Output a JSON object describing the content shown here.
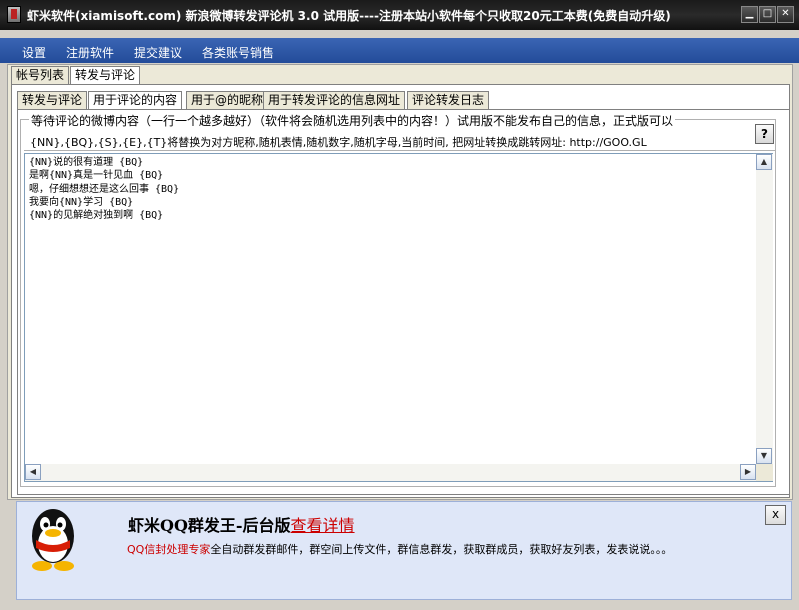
{
  "window": {
    "title": "虾米软件(xiamisoft.com) 新浪微博转发评论机 3.0 试用版----注册本站小软件每个只收取20元工本费(免费自动升级)",
    "min_glyph": "▁",
    "max_glyph": "□",
    "close_glyph": "✕"
  },
  "menu": {
    "items": [
      "设置",
      "注册软件",
      "提交建议",
      "各类账号销售"
    ]
  },
  "main_tabs": {
    "items": [
      "帐号列表",
      "转发与评论"
    ],
    "active_index": 1
  },
  "sub_tabs": {
    "items": [
      "转发与评论",
      "用于评论的内容",
      "用于@的昵称",
      "用于转发评论的信息网址",
      "评论转发日志"
    ],
    "active_index": 1
  },
  "group": {
    "legend": "等待评论的微博内容（一行一个越多越好）（软件将会随机选用列表中的内容！）试用版不能发布自己的信息，正式版可以",
    "help_label": "?",
    "hint": "{NN},{BQ},{S},{E},{T}将替换为对方昵称,随机表情,随机数字,随机字母,当前时间, 把网址转换成跳转网址: http://GOO.GL"
  },
  "editor": {
    "lines": [
      "{NN}说的很有道理 {BQ}",
      "是啊{NN}真是一针见血 {BQ}",
      "嗯，仔细想想还是这么回事 {BQ}",
      "我要向{NN}学习 {BQ}",
      "{NN}的见解绝对独到啊 {BQ}"
    ]
  },
  "ad": {
    "title": "虾米QQ群发王-后台版",
    "link": "查看详情",
    "desc_highlight": "QQ信封处理专家",
    "desc_rest": "全自动群发群邮件，群空间上传文件，群信息群发，获取群成员，获取好友列表，发表说说。。。",
    "close_label": "x"
  },
  "colors": {
    "menu_bg": "#2c56a6",
    "ad_bg": "#dfe7f8",
    "link_red": "#cc0000"
  }
}
